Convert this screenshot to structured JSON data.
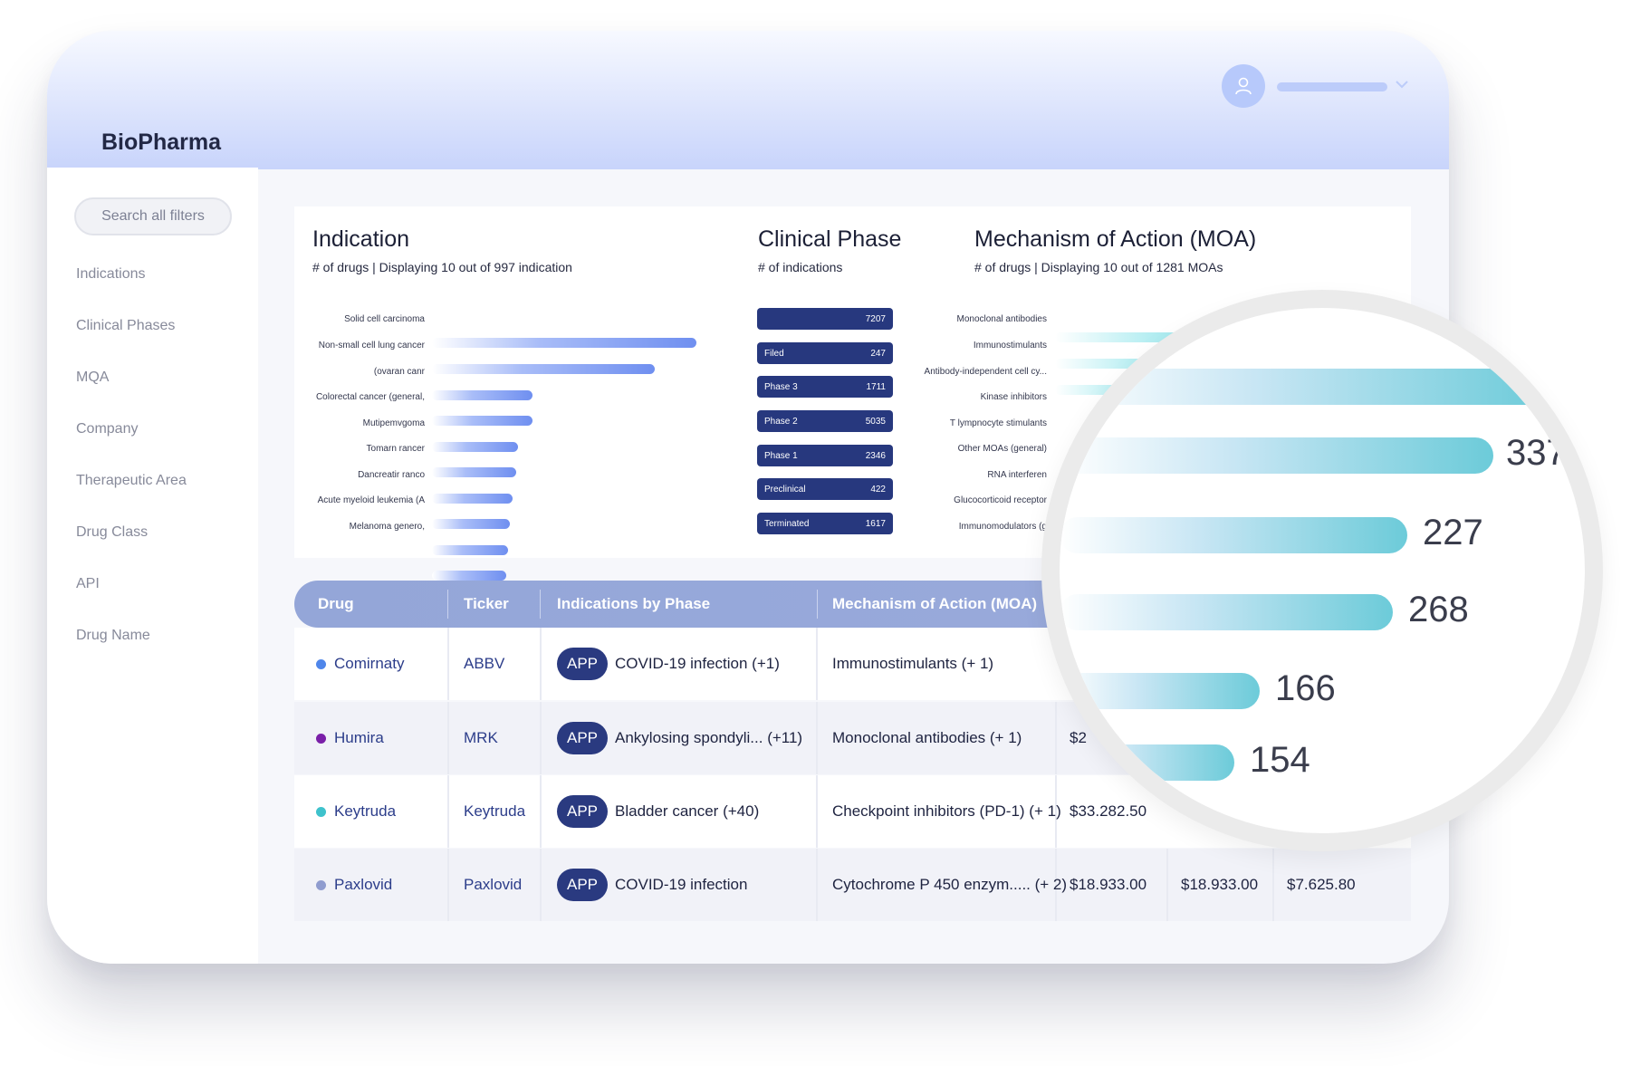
{
  "app": {
    "brand": "BioPharma"
  },
  "sidebar": {
    "search_label": "Search all filters",
    "items": [
      "Indications",
      "Clinical Phases",
      "MQA",
      "Company",
      "Therapeutic Area",
      "Drug Class",
      "API",
      "Drug Name"
    ]
  },
  "indication": {
    "title": "Indication",
    "subtitle": "# of drugs | Displaying 10 out of 997 indication",
    "labels": [
      "Solid cell carcinoma",
      "Non-small cell lung cancer",
      "(ovaran canr",
      "Colorectal cancer (general,",
      "Mutipemvgoma",
      "Tomarn rancer",
      "Dancreatir ranco",
      "Acute myeloid leukemia (A",
      "Melanoma genero,"
    ]
  },
  "clinical_phase": {
    "title": "Clinical Phase",
    "subtitle": "# of indications",
    "rows": [
      {
        "label": "",
        "value": "7207"
      },
      {
        "label": "Filed",
        "value": "247"
      },
      {
        "label": "Phase 3",
        "value": "1711"
      },
      {
        "label": "Phase 2",
        "value": "5035"
      },
      {
        "label": "Phase 1",
        "value": "2346"
      },
      {
        "label": "Preclinical",
        "value": "422"
      },
      {
        "label": "Terminated",
        "value": "1617"
      }
    ]
  },
  "moa": {
    "title": "Mechanism of Action (MOA)",
    "subtitle": "# of drugs | Displaying 10 out of 1281 MOAs",
    "labels": [
      "Monoclonal antibodies",
      "Immunostimulants",
      "Antibody-independent cell cy...",
      "Kinase inhibitors",
      "T lympnocyte stimulants",
      "Other MOAs (general)",
      "RNA interferen",
      "Glucocorticoid receptor",
      "Immunomodulators (g"
    ]
  },
  "table": {
    "headers": [
      "Drug",
      "Ticker",
      "Indications by Phase",
      "Mechanism of Action (MOA)"
    ],
    "rows": [
      {
        "drug": "Comirnaty",
        "ticker": "ABBV",
        "phase": "APP",
        "indication": "COVID-19 infection (+1)",
        "moa": "Immunostimulants (+ 1)",
        "v1": "",
        "v2": "",
        "v3": ""
      },
      {
        "drug": "Humira",
        "ticker": "MRK",
        "phase": "APP",
        "indication": "Ankylosing spondyli... (+11)",
        "moa": "Monoclonal antibodies (+ 1)",
        "v1": "$2",
        "v2": "",
        "v3": ""
      },
      {
        "drug": "Keytruda",
        "ticker": "Keytruda",
        "phase": "APP",
        "indication": "Bladder cancer (+40)",
        "moa": "Checkpoint inhibitors (PD-1) (+ 1)",
        "v1": "$33.282.50",
        "v2": "",
        "v3": ""
      },
      {
        "drug": "Paxlovid",
        "ticker": "Paxlovid",
        "phase": "APP",
        "indication": "COVID-19 infection",
        "moa": "Cytochrome P 450 enzym..... (+ 2)",
        "v1": "$18.933.00",
        "v2": "$18.933.00",
        "v3": "$7.625.80"
      }
    ]
  },
  "colors": {
    "dots": [
      "#4f86ea",
      "#7a1fa8",
      "#3ec2cc",
      "#8f9ccf"
    ],
    "accent": "#2a3a80"
  },
  "magnifier": {
    "values": [
      "337",
      "227",
      "268",
      "166",
      "154"
    ]
  }
}
